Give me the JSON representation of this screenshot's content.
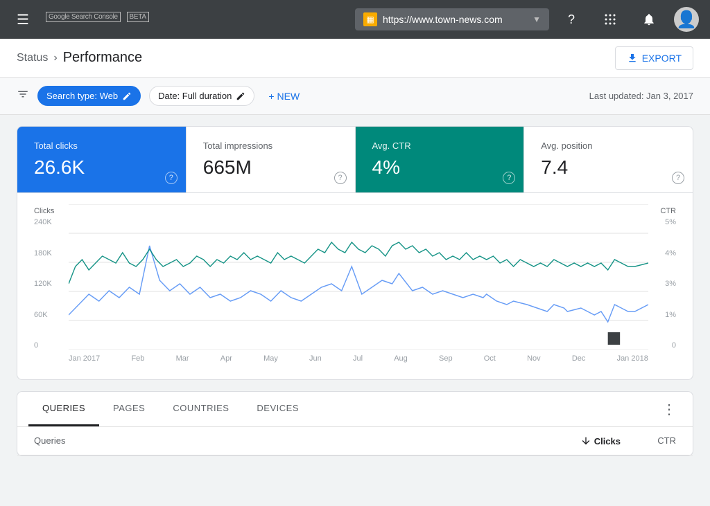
{
  "nav": {
    "menu_label": "Menu",
    "logo": "Google Search Console",
    "beta": "BETA",
    "url": "https://www.town-news.com",
    "help_icon": "?",
    "apps_icon": "⋮⋮⋮",
    "notifications_icon": "🔔"
  },
  "breadcrumb": {
    "parent": "Status",
    "separator": "›",
    "current": "Performance",
    "export_label": "EXPORT"
  },
  "filter_bar": {
    "search_type_label": "Search type: Web",
    "date_label": "Date: Full duration",
    "new_label": "NEW",
    "last_updated": "Last updated: Jan 3, 2017"
  },
  "metrics": {
    "total_clicks": {
      "label": "Total clicks",
      "value": "26.6K"
    },
    "total_impressions": {
      "label": "Total impressions",
      "value": "665M"
    },
    "avg_ctr": {
      "label": "Avg. CTR",
      "value": "4%"
    },
    "avg_position": {
      "label": "Avg. position",
      "value": "7.4"
    }
  },
  "chart": {
    "y_left_label": "Clicks",
    "y_right_label": "CTR",
    "y_left_ticks": [
      "240K",
      "180K",
      "120K",
      "60K",
      "0"
    ],
    "y_right_ticks": [
      "5%",
      "4%",
      "3%",
      "1%",
      "0"
    ],
    "x_ticks": [
      "Jan 2017",
      "Feb",
      "Mar",
      "Apr",
      "May",
      "Jun",
      "Jul",
      "Aug",
      "Sep",
      "Oct",
      "Nov",
      "Dec",
      "Jan 2018"
    ]
  },
  "tabs": {
    "items": [
      {
        "label": "QUERIES",
        "active": true
      },
      {
        "label": "PAGES",
        "active": false
      },
      {
        "label": "COUNTRIES",
        "active": false
      },
      {
        "label": "DEVICES",
        "active": false
      }
    ],
    "more_label": "⋮"
  },
  "table_header": {
    "col_main": "Queries",
    "col_clicks": "Clicks",
    "col_ctr": "CTR"
  }
}
